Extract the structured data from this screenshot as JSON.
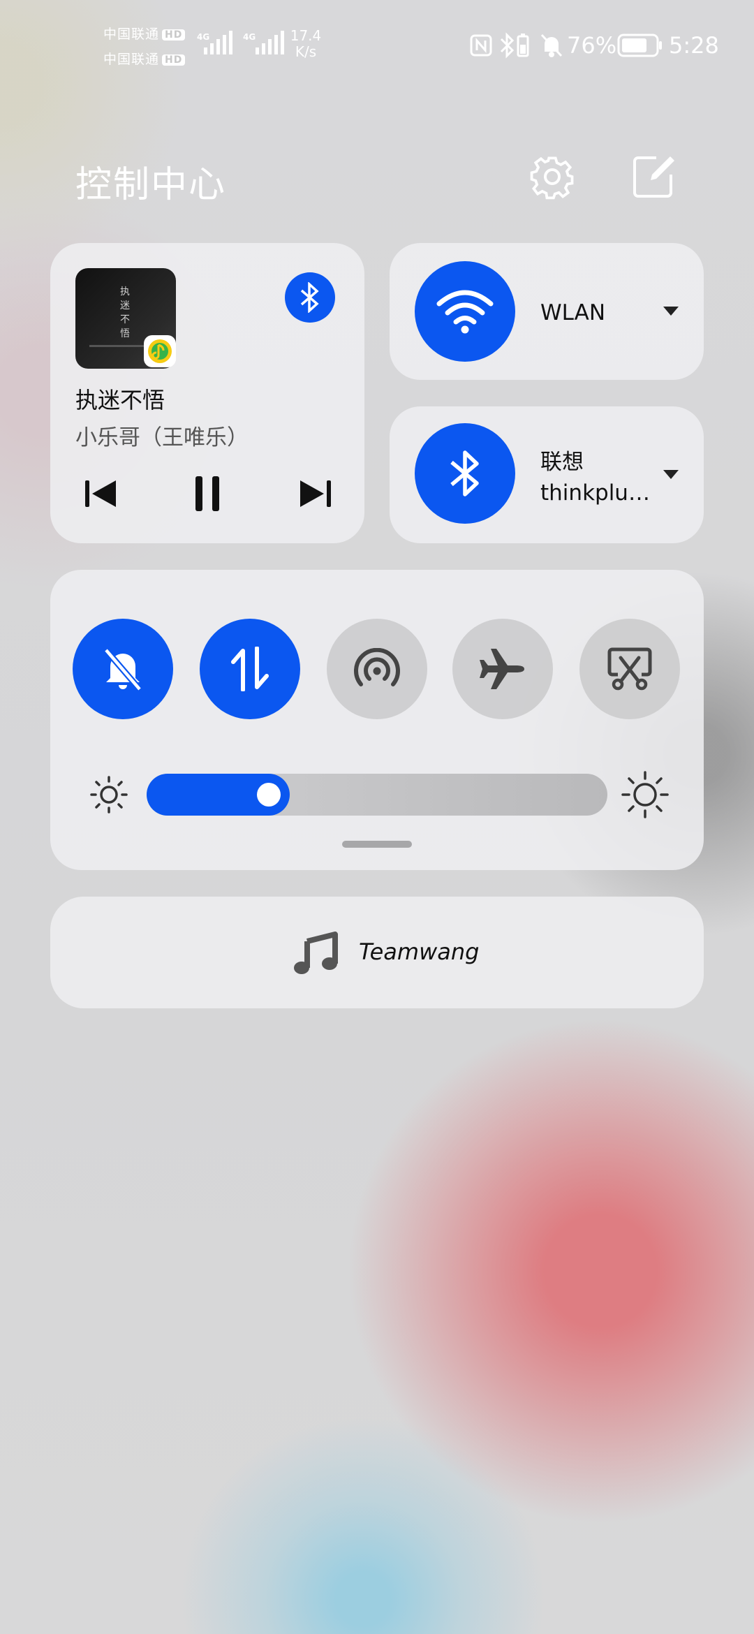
{
  "status_bar": {
    "carrier_1": "中国联通",
    "carrier_2": "中国联通",
    "hd_badge": "HD",
    "network_1": "4G",
    "network_2": "4G",
    "speed_value": "17.4",
    "speed_unit": "K/s",
    "battery_percent": "76%",
    "battery_level": 0.76,
    "time": "5:28",
    "icons": [
      "nfc-icon",
      "bluetooth-battery-icon",
      "mute-icon",
      "battery-icon"
    ]
  },
  "header": {
    "title": "控制中心",
    "settings_icon": "gear-icon",
    "edit_icon": "edit-icon"
  },
  "media": {
    "album_text": "执迷不悟",
    "song_title": "执迷不悟",
    "artist": "小乐哥（王唯乐）",
    "output_icon": "bluetooth-icon",
    "app_icon": "qq-music-icon",
    "controls": [
      "previous-icon",
      "pause-icon",
      "next-icon"
    ]
  },
  "wifi_tile": {
    "label": "WLAN",
    "icon": "wifi-icon",
    "active": true
  },
  "bluetooth_tile": {
    "label_line1": "联想",
    "label_line2": "thinkplu…",
    "icon": "bluetooth-icon",
    "active": true
  },
  "toggles": [
    {
      "name": "mute",
      "icon": "bell-off-icon",
      "active": true
    },
    {
      "name": "mobile-data",
      "icon": "data-transfer-icon",
      "active": true
    },
    {
      "name": "hotspot",
      "icon": "hotspot-icon",
      "active": false
    },
    {
      "name": "airplane-mode",
      "icon": "airplane-icon",
      "active": false
    },
    {
      "name": "screenshot",
      "icon": "scissors-icon",
      "active": false
    }
  ],
  "brightness": {
    "level": 0.31,
    "low_icon": "sun-small-icon",
    "high_icon": "sun-large-icon"
  },
  "now_playing_device": {
    "icon": "music-note-icon",
    "label": "Teamwang"
  },
  "colors": {
    "accent": "#0b57f0",
    "card": "#eeeef0",
    "inactive": "#cdcdcf"
  }
}
